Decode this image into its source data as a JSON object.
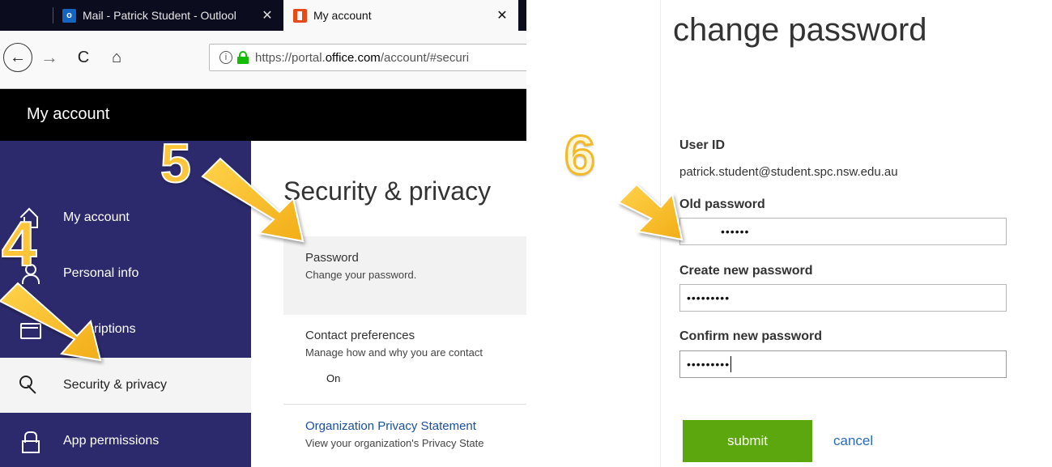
{
  "browser": {
    "tabs": [
      {
        "label": "Mail - Patrick Student - Outlool",
        "icon": "outlook-icon",
        "icon_text": "o"
      },
      {
        "label": "My account",
        "icon": "office-icon"
      }
    ],
    "close_glyph": "✕",
    "nav": {
      "back": "←",
      "forward": "→",
      "reload": "C",
      "home": "⌂"
    },
    "url": {
      "prefix": "https://portal.",
      "domain": "office.com",
      "suffix": "/account/#securi",
      "info_glyph": "i"
    }
  },
  "header": {
    "title": "My account"
  },
  "sidebar": {
    "items": [
      {
        "label": "My account",
        "icon": "home-icon"
      },
      {
        "label": "Personal info",
        "icon": "person-icon"
      },
      {
        "label": "criptions",
        "icon": "card-icon"
      },
      {
        "label": "Security & privacy",
        "icon": "key-icon",
        "active": true
      },
      {
        "label": "App permissions",
        "icon": "lock-icon"
      }
    ],
    "background_color": "#2c2a6c"
  },
  "main": {
    "title": "Security & privacy",
    "sections": [
      {
        "title": "Password",
        "description": "Change your password."
      },
      {
        "title": "Contact preferences",
        "description": "Manage how and why you are contact",
        "value": "On"
      },
      {
        "title": "Organization Privacy Statement",
        "description": "View your organization's Privacy State"
      }
    ]
  },
  "change_password": {
    "title": "change password",
    "user_id_label": "User ID",
    "user_id_value": "patrick.student@student.spc.nsw.edu.au",
    "old_password_label": "Old password",
    "old_password_value": "••••••",
    "new_password_label": "Create new password",
    "new_password_value": "•••••••••",
    "confirm_password_label": "Confirm new password",
    "confirm_password_value": "•••••••••",
    "submit_label": "submit",
    "cancel_label": "cancel",
    "submit_color": "#5da70e"
  },
  "annotations": {
    "steps": [
      "4",
      "5",
      "6"
    ],
    "color": "#ffc53a"
  }
}
